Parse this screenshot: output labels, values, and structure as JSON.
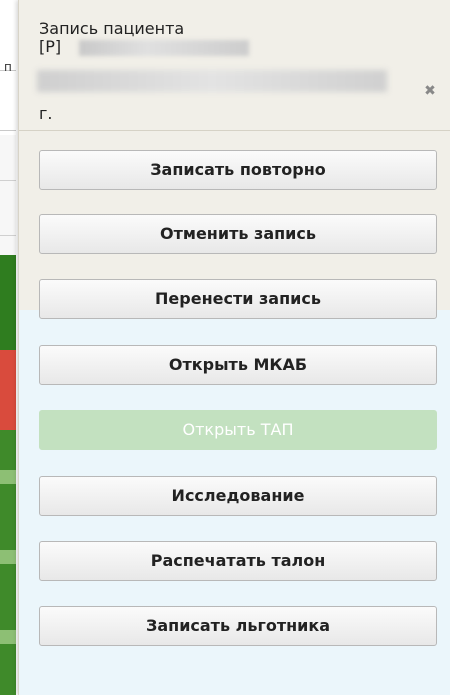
{
  "dialog": {
    "title": "Запись пациента",
    "line2": "[Р]",
    "line3": "г.",
    "close_icon": "close-icon"
  },
  "background": {
    "mark_top": "п",
    "mark_mid": "•"
  },
  "buttons": [
    {
      "label": "Записать повторно",
      "enabled": true
    },
    {
      "label": "Отменить запись",
      "enabled": true
    },
    {
      "label": "Перенести запись",
      "enabled": true
    },
    {
      "label": "Открыть МКАБ",
      "enabled": true
    },
    {
      "label": "Открыть ТАП",
      "enabled": false
    },
    {
      "label": "Исследование",
      "enabled": true
    },
    {
      "label": "Распечатать талон",
      "enabled": true
    },
    {
      "label": "Записать льготника",
      "enabled": true
    }
  ],
  "colors": {
    "panel_bg": "#f1efe8",
    "panel_lower_bg": "#ebf6fb",
    "disabled_button_bg": "#c3e1c0",
    "bg_green": "#2f7d1f",
    "bg_red": "#d94b3d"
  }
}
